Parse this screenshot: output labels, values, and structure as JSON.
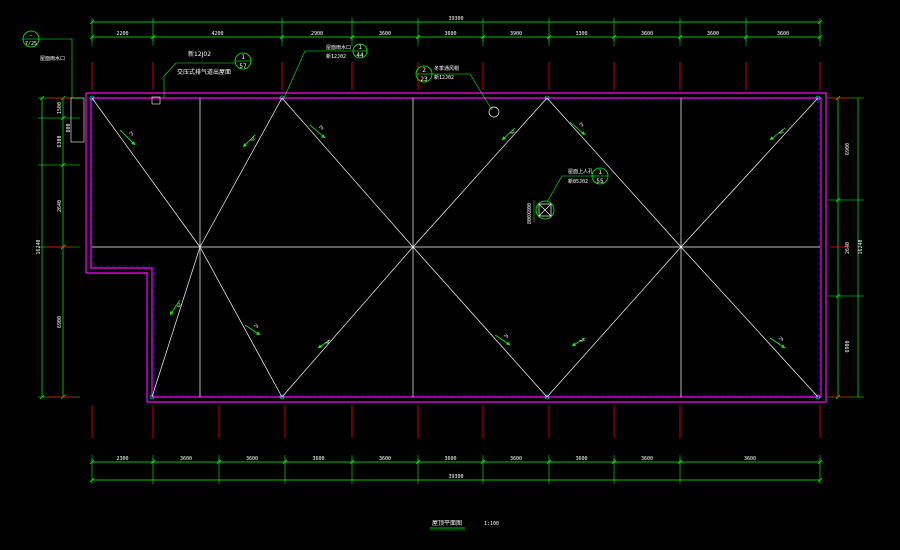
{
  "colors": {
    "background": "#000000",
    "dimension": "#00ff00",
    "axis_tick": "#ff0000",
    "parapet": "#ff00ff",
    "ridge": "#ffffff",
    "marker": "#00ff00",
    "text": "#ffffff"
  },
  "dimensions": {
    "top_overall": "39300",
    "top_segments": [
      "2200",
      "4200",
      "2900",
      "3600",
      "3600",
      "3900",
      "3300",
      "3600",
      "3600",
      "3600"
    ],
    "bottom_overall": "39300",
    "bottom_segments": [
      "2300",
      "3600",
      "3600",
      "3600",
      "3600",
      "3600",
      "3600",
      "3600",
      "3600",
      "3600"
    ],
    "left_overall": "16240",
    "left_segments": [
      "1500",
      "6300",
      "2640",
      "6900"
    ],
    "left_extra": "800",
    "right_overall": "16240",
    "right_segments": [
      "6900",
      "2640",
      "6900"
    ]
  },
  "annotations": {
    "vent_outlet_label": "交压式排气道出屋面",
    "vent_outlet_ref_std": "新12J02",
    "vent_outlet_ref_num": "1",
    "vent_outlet_ref_page": "57",
    "roof_drain_label": "屋面雨水口",
    "roof_drain_ref_std": "新12J02",
    "roof_drain_ref_num": "1",
    "roof_drain_ref_page": "44",
    "vent_pipe_label": "冬季通风帽",
    "vent_pipe_ref_std": "新12J02",
    "vent_pipe_ref_num": "2",
    "vent_pipe_ref_page": "23",
    "hatch_label": "屋面上人孔",
    "hatch_ref_std": "新05J02",
    "hatch_ref_num": "1",
    "hatch_ref_page": "55",
    "hatch_size": "800X800",
    "corner_ref_top": "—",
    "corner_ref_bottom": "7/25",
    "corner_note": "屋面雨水口"
  },
  "slope_label": "2%",
  "title": {
    "name": "屋顶平面图",
    "scale": "1:100"
  }
}
